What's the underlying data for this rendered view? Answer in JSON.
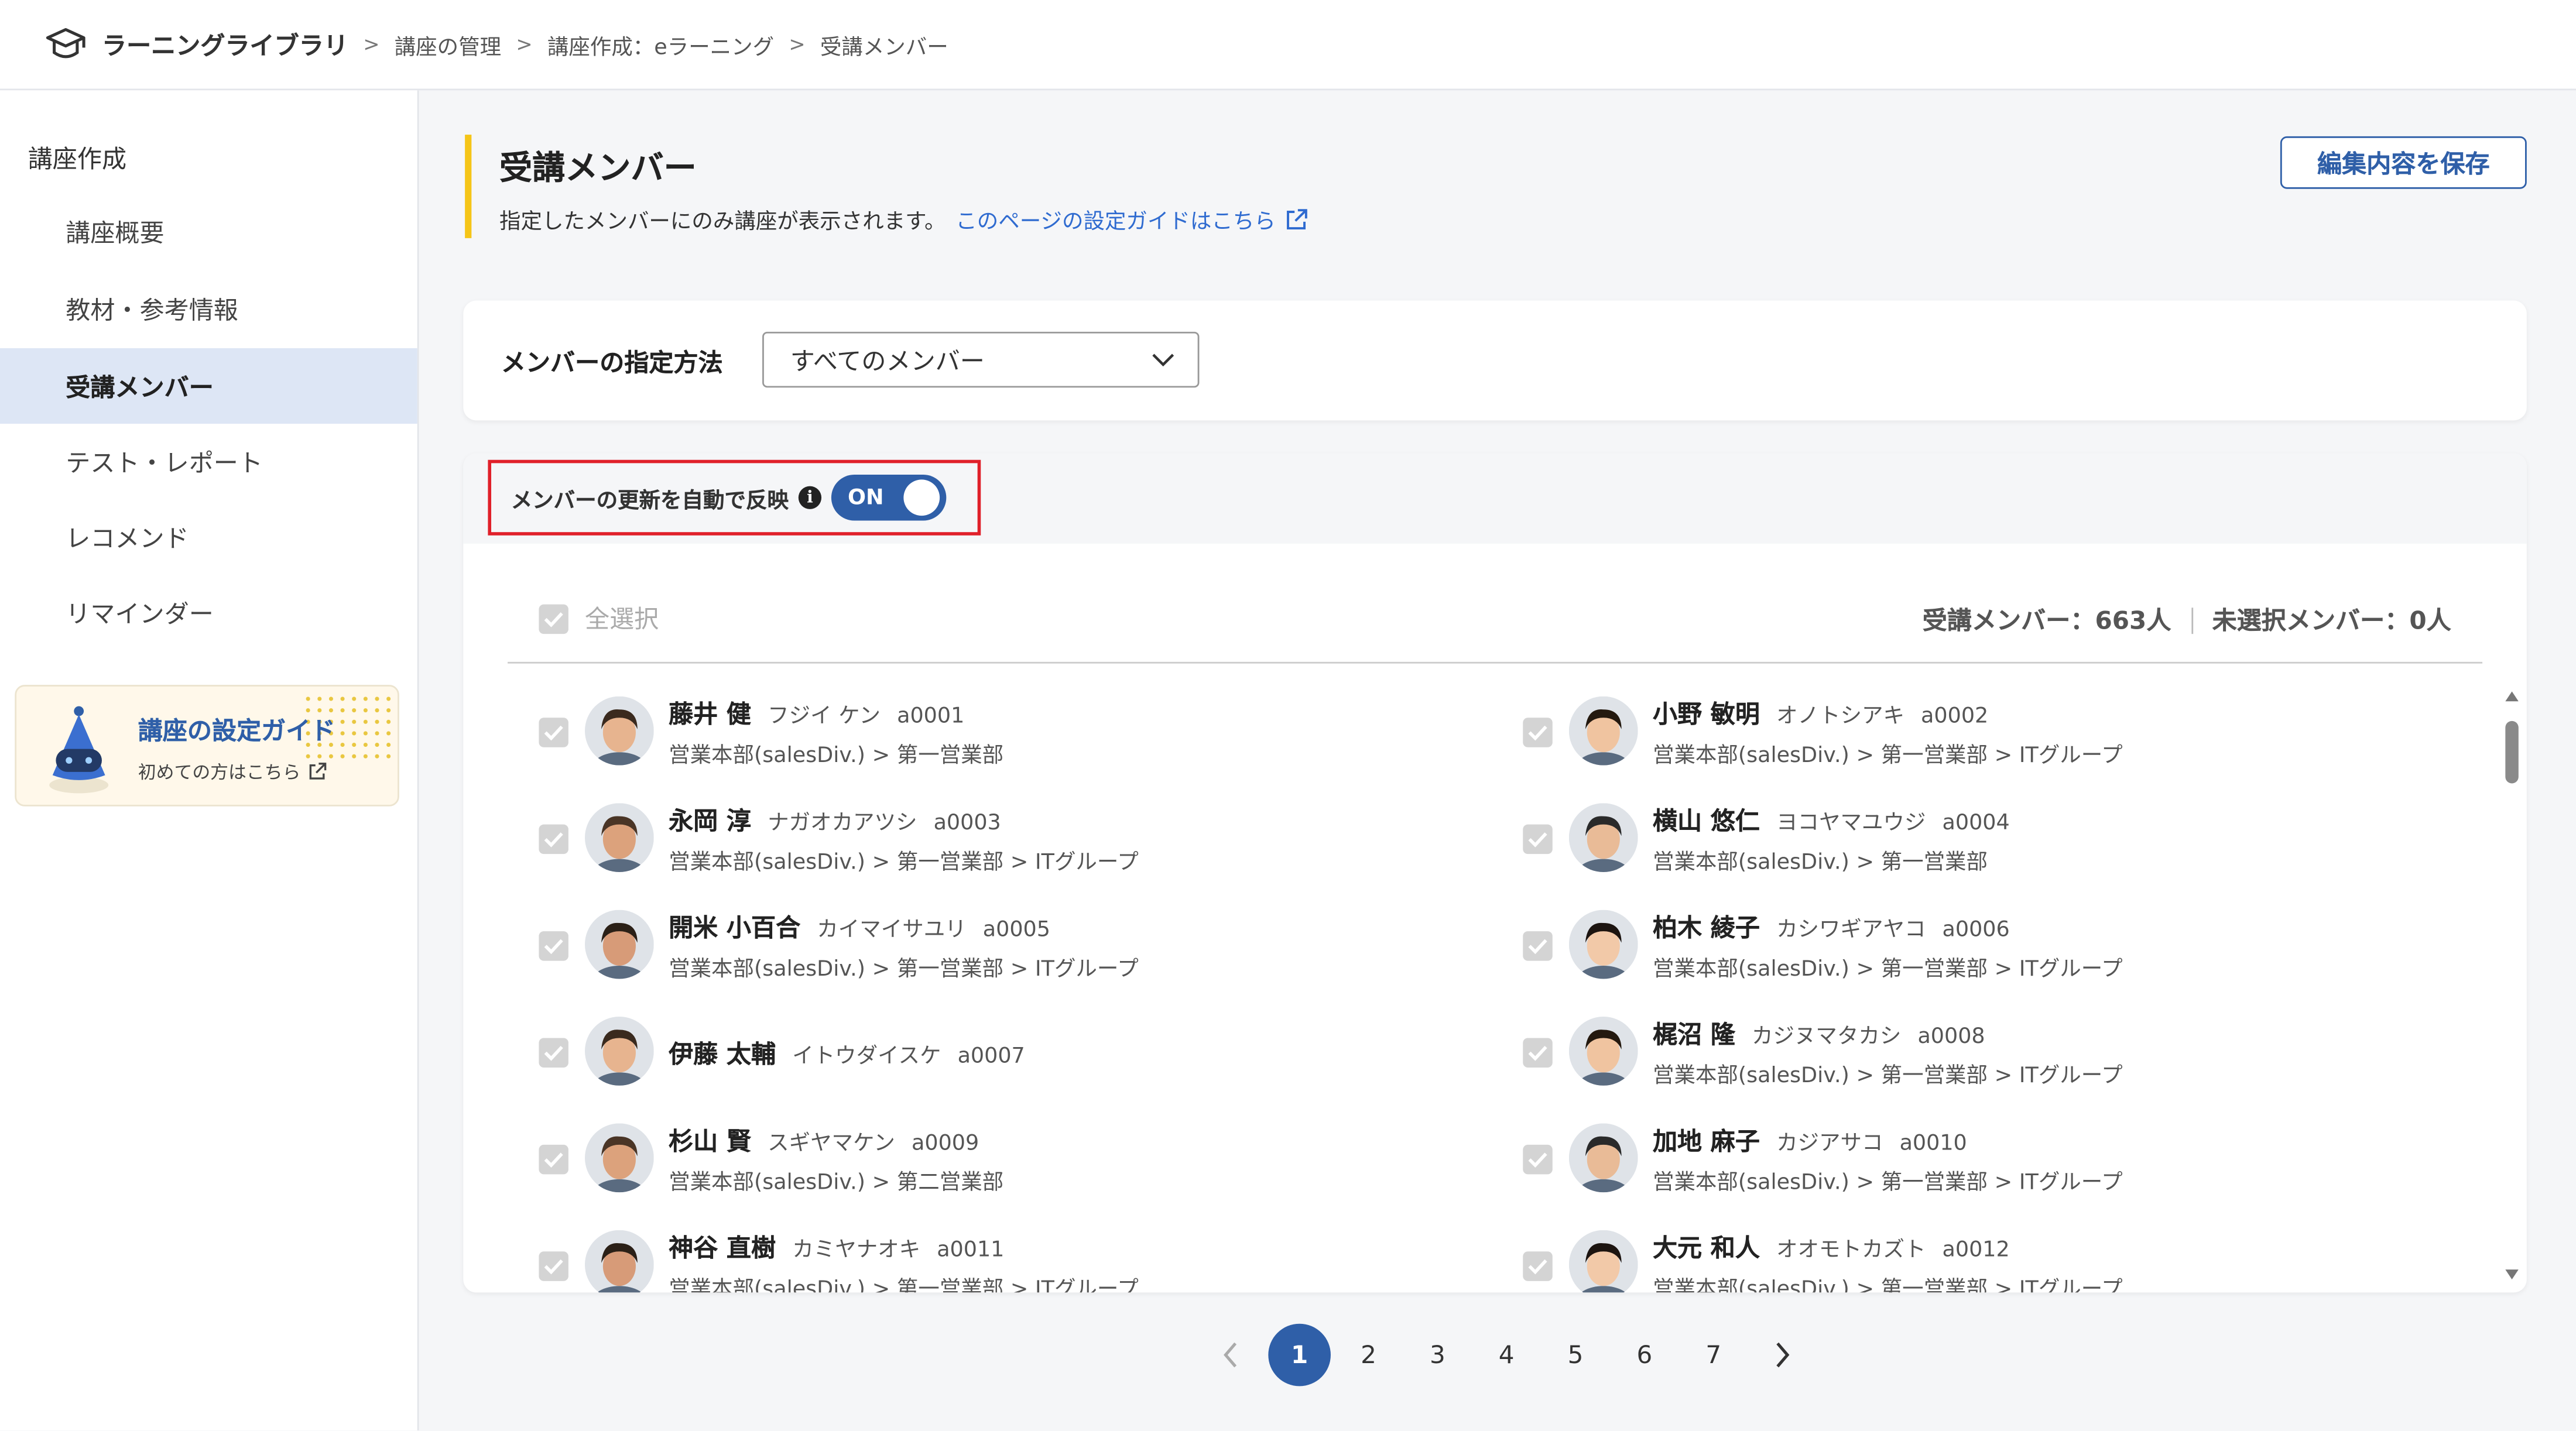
{
  "header": {
    "app_title": "ラーニングライブラリ",
    "breadcrumbs": [
      "講座の管理",
      "講座作成：eラーニング",
      "受講メンバー"
    ]
  },
  "sidebar": {
    "heading": "講座作成",
    "items": [
      {
        "label": "講座概要"
      },
      {
        "label": "教材・参考情報"
      },
      {
        "label": "受講メンバー",
        "active": true
      },
      {
        "label": "テスト・レポート"
      },
      {
        "label": "レコメンド"
      },
      {
        "label": "リマインダー"
      }
    ],
    "guide": {
      "title": "講座の設定ガイド",
      "subtitle": "初めての方はこちら"
    }
  },
  "main": {
    "title": "受講メンバー",
    "description": "指定したメンバーにのみ講座が表示されます。",
    "guide_link": "このページの設定ガイドはこちら",
    "save_button": "編集内容を保存",
    "method": {
      "label": "メンバーの指定方法",
      "selected": "すべてのメンバー"
    },
    "auto_update": {
      "label": "メンバーの更新を自動で反映",
      "toggle": "ON",
      "state": true
    },
    "select_all": "全選択",
    "counts": {
      "enrolled_label": "受講メンバー：",
      "enrolled": "663人",
      "unselected_label": "未選択メンバー：",
      "unselected": "0人"
    },
    "members": [
      {
        "name": "藤井 健",
        "kana": "フジイ ケン",
        "id": "a0001",
        "dept": "営業本部(salesDiv.) > 第一営業部"
      },
      {
        "name": "小野 敏明",
        "kana": "オノトシアキ",
        "id": "a0002",
        "dept": "営業本部(salesDiv.) > 第一営業部 > ITグループ"
      },
      {
        "name": "永岡 淳",
        "kana": "ナガオカアツシ",
        "id": "a0003",
        "dept": "営業本部(salesDiv.) > 第一営業部 > ITグループ"
      },
      {
        "name": "横山 悠仁",
        "kana": "ヨコヤマユウジ",
        "id": "a0004",
        "dept": "営業本部(salesDiv.) > 第一営業部"
      },
      {
        "name": "開米 小百合",
        "kana": "カイマイサユリ",
        "id": "a0005",
        "dept": "営業本部(salesDiv.) > 第一営業部 > ITグループ"
      },
      {
        "name": "柏木 綾子",
        "kana": "カシワギアヤコ",
        "id": "a0006",
        "dept": "営業本部(salesDiv.) > 第一営業部 > ITグループ"
      },
      {
        "name": "伊藤 太輔",
        "kana": "イトウダイスケ",
        "id": "a0007",
        "dept": ""
      },
      {
        "name": "梶沼 隆",
        "kana": "カジヌマタカシ",
        "id": "a0008",
        "dept": "営業本部(salesDiv.) > 第一営業部 > ITグループ"
      },
      {
        "name": "杉山 賢",
        "kana": "スギヤマケン",
        "id": "a0009",
        "dept": "営業本部(salesDiv.) > 第二営業部"
      },
      {
        "name": "加地 麻子",
        "kana": "カジアサコ",
        "id": "a0010",
        "dept": "営業本部(salesDiv.) > 第一営業部 > ITグループ"
      },
      {
        "name": "神谷 直樹",
        "kana": "カミヤナオキ",
        "id": "a0011",
        "dept": "営業本部(salesDiv.) > 第一営業部 > ITグループ"
      },
      {
        "name": "大元 和人",
        "kana": "オオモトカズト",
        "id": "a0012",
        "dept": "営業本部(salesDiv.) > 第一営業部 > ITグループ"
      }
    ],
    "pagination": {
      "pages": [
        "1",
        "2",
        "3",
        "4",
        "5",
        "6",
        "7"
      ],
      "current": "1"
    }
  },
  "colors": {
    "accent": "#2f5fa8",
    "highlight": "#e0202a",
    "title_bar": "#f5c518"
  }
}
